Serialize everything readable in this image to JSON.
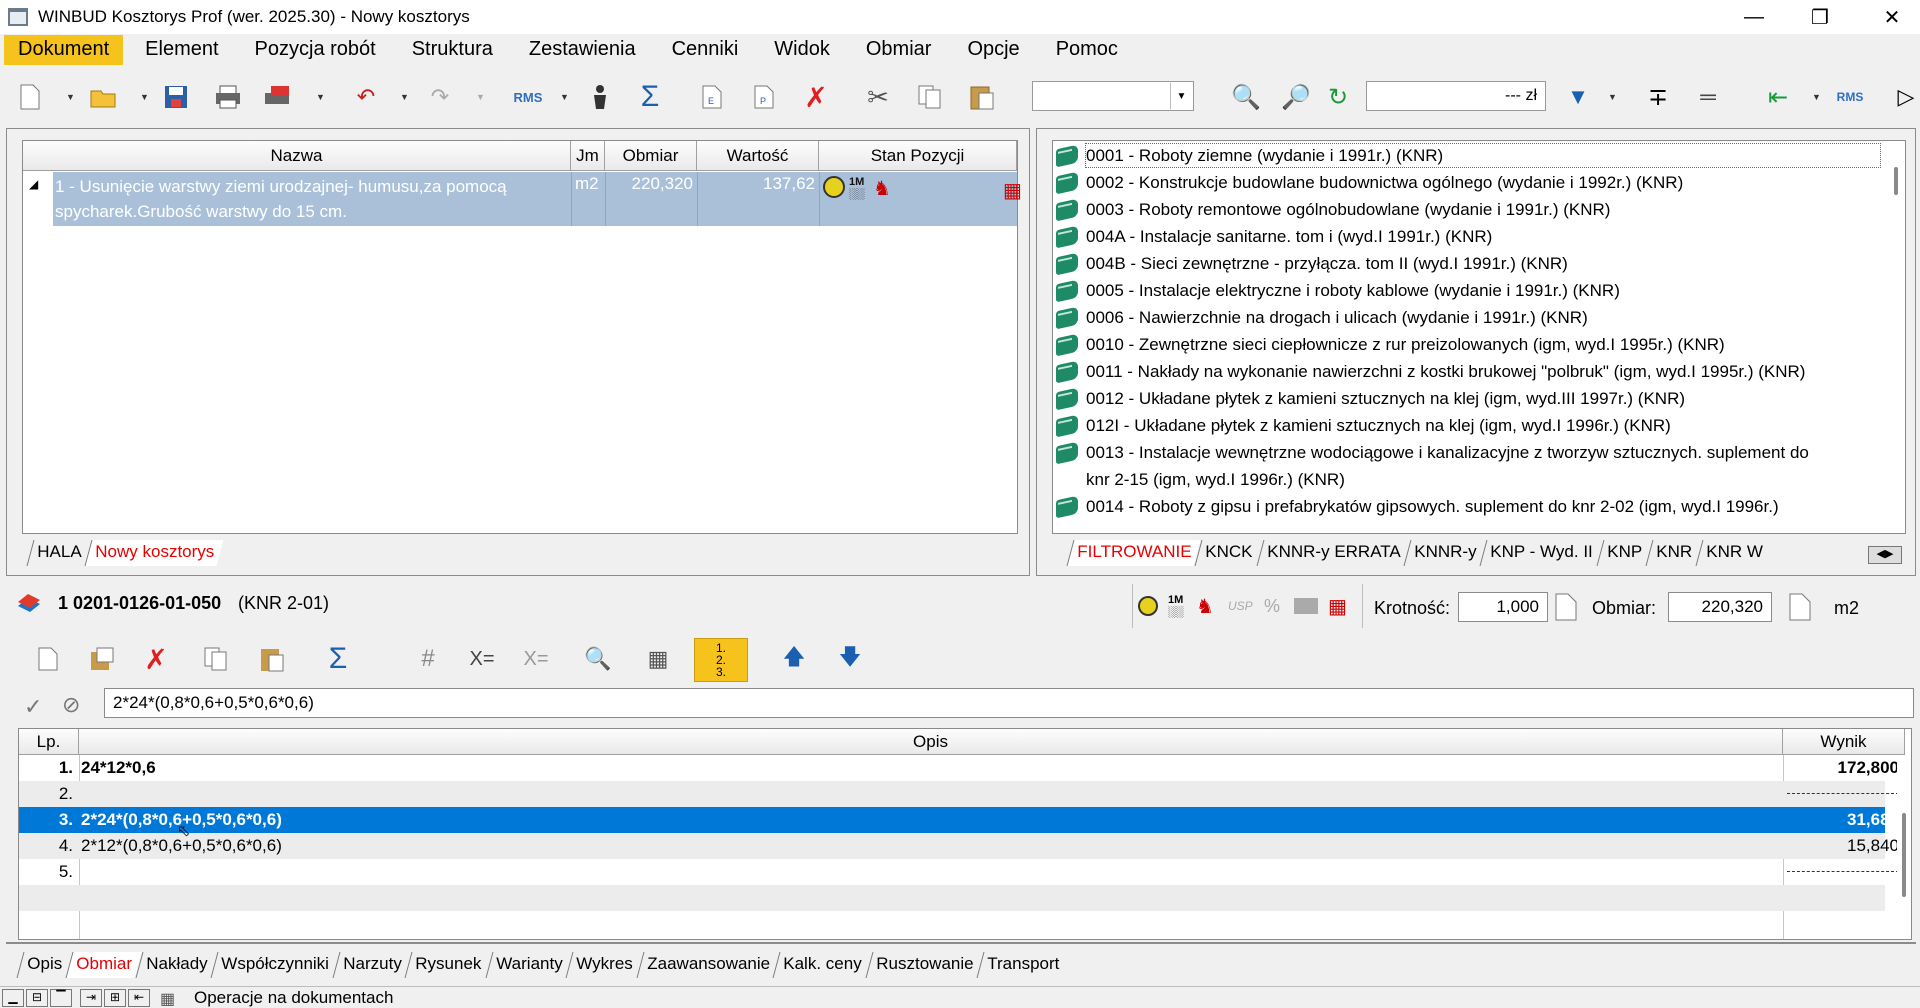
{
  "window": {
    "title": "WINBUD Kosztorys Prof (wer. 2025.30) - Nowy kosztorys"
  },
  "menu": [
    "Dokument",
    "Element",
    "Pozycja robót",
    "Struktura",
    "Zestawienia",
    "Cenniki",
    "Widok",
    "Obmiar",
    "Opcje",
    "Pomoc"
  ],
  "toolbar": {
    "price_field": "--- zł"
  },
  "positions": {
    "headers": {
      "name": "Nazwa",
      "unit": "Jm",
      "measure": "Obmiar",
      "value": "Wartość",
      "state": "Stan Pozycji"
    },
    "rows": [
      {
        "name": "1 - Usunięcie warstwy ziemi urodzajnej- humusu,za pomocą spycharek.Grubość warstwy do 15 cm.",
        "unit": "m2",
        "measure": "220,320",
        "value": "137,62"
      }
    ],
    "tabs": [
      "HALA",
      "Nowy kosztorys"
    ]
  },
  "catalog": {
    "items": [
      "0001 - Roboty ziemne (wydanie i 1991r.) (KNR)",
      "0002 - Konstrukcje budowlane budownictwa ogólnego (wydanie i 1992r.) (KNR)",
      "0003 - Roboty remontowe ogólnobudowlane (wydanie i 1991r.) (KNR)",
      "004A - Instalacje sanitarne. tom i (wyd.I 1991r.) (KNR)",
      "004B - Sieci zewnętrzne - przyłącza. tom II (wyd.I 1991r.) (KNR)",
      "0005 - Instalacje elektryczne i roboty kablowe (wydanie i 1991r.) (KNR)",
      "0006 - Nawierzchnie na drogach i ulicach (wydanie i 1991r.) (KNR)",
      "0010 - Zewnętrzne sieci ciepłownicze z rur preizolowanych (igm, wyd.I 1995r.) (KNR)",
      "0011 - Nakłady na wykonanie nawierzchni z kostki brukowej \"polbruk\" (igm, wyd.I 1995r.) (KNR)",
      "0012 - Układane płytek z kamieni sztucznych na klej (igm, wyd.III 1997r.) (KNR)",
      "012I - Układane płytek z kamieni sztucznych na klej (igm, wyd.I 1996r.) (KNR)",
      "0013 - Instalacje wewnętrzne wodociągowe i kanalizacyjne z tworzyw sztucznych. suplement do",
      "knr 2-15 (igm, wyd.I 1996r.) (KNR)",
      "0014 - Roboty z gipsu i prefabrykatów gipsowych. suplement do knr 2-02 (igm, wyd.I 1996r.)"
    ],
    "tabs": [
      "FILTROWANIE",
      "KNCK",
      "KNNR-y ERRATA",
      "KNNR-y",
      "KNP - Wyd. II",
      "KNP",
      "KNR",
      "KNR W"
    ]
  },
  "position_detail": {
    "code": "1 0201-0126-01-050",
    "catalog": "(KNR 2-01)",
    "multiplicity_label": "Krotność:",
    "multiplicity": "1,000",
    "measure_label": "Obmiar:",
    "measure": "220,320",
    "unit": "m2"
  },
  "formula": "2*24*(0,8*0,6+0,5*0,6*0,6)",
  "measure_table": {
    "headers": {
      "lp": "Lp.",
      "desc": "Opis",
      "result": "Wynik"
    },
    "rows": [
      {
        "lp": "1.",
        "desc": "24*12*0,6",
        "result": "172,800",
        "bold": true
      },
      {
        "lp": "2.",
        "desc": "",
        "result": ""
      },
      {
        "lp": "3.",
        "desc": "2*24*(0,8*0,6+0,5*0,6*0,6)",
        "result": "31,680",
        "selected": true
      },
      {
        "lp": "4.",
        "desc": "2*12*(0,8*0,6+0,5*0,6*0,6)",
        "result": "15,840"
      },
      {
        "lp": "5.",
        "desc": "",
        "result": ""
      }
    ]
  },
  "bottom_tabs": [
    "Opis",
    "Obmiar",
    "Nakłady",
    "Współczynniki",
    "Narzuty",
    "Rysunek",
    "Warianty",
    "Wykres",
    "Zaawansowanie",
    "Kalk. ceny",
    "Rusztowanie",
    "Transport"
  ],
  "statusbar": {
    "text": "Operacje na dokumentach"
  }
}
